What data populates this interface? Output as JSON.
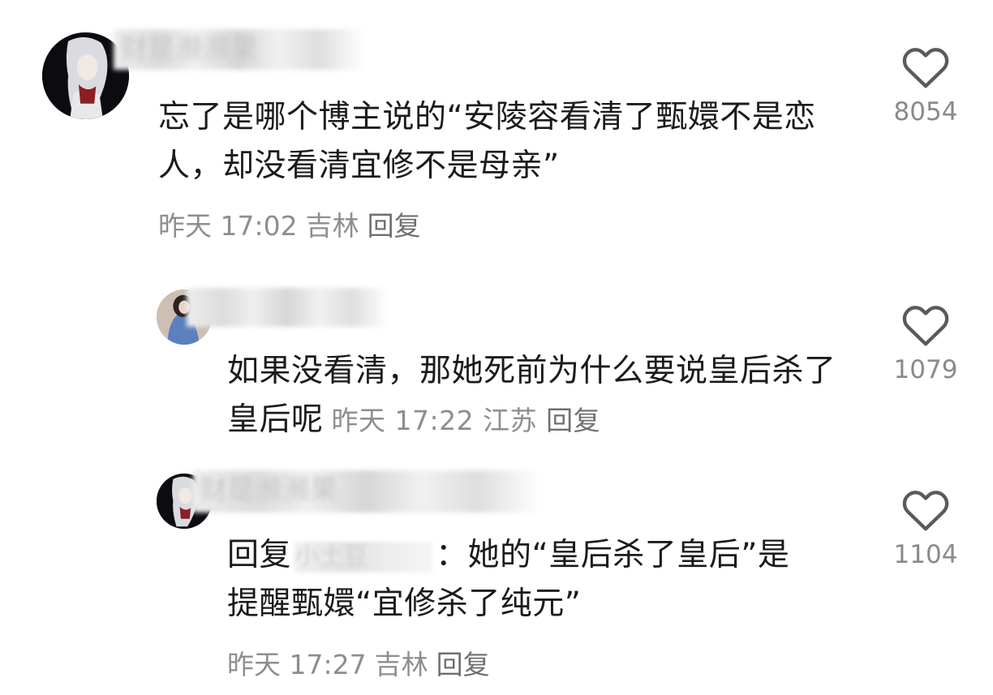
{
  "comments": [
    {
      "username": "财是濒濒果",
      "text": "忘了是哪个博主说的“安陵容看清了甄嬛不是恋人，却没看清宜修不是母亲”",
      "time": "昨天 17:02",
      "location": "吉林",
      "reply_label": "回复",
      "likes": "8054"
    },
    {
      "username": "",
      "text": "如果没看清，那她死前为什么要说皇后杀了皇后呢",
      "time": "昨天 17:22",
      "location": "江苏",
      "reply_label": "回复",
      "likes": "1079"
    },
    {
      "username": "财是濒濒果",
      "reply_prefix": "回复",
      "mention": "小土豆",
      "text": "：她的“皇后杀了皇后”是提醒甄嬛“宜修杀了纯元”",
      "time": "昨天 17:27",
      "location": "吉林",
      "reply_label": "回复",
      "likes": "1104"
    }
  ],
  "icons": {
    "like": "heart-outline-icon"
  },
  "colors": {
    "text": "#1b1b1b",
    "meta": "#8e8e8e",
    "icon": "#5a5a5a"
  }
}
